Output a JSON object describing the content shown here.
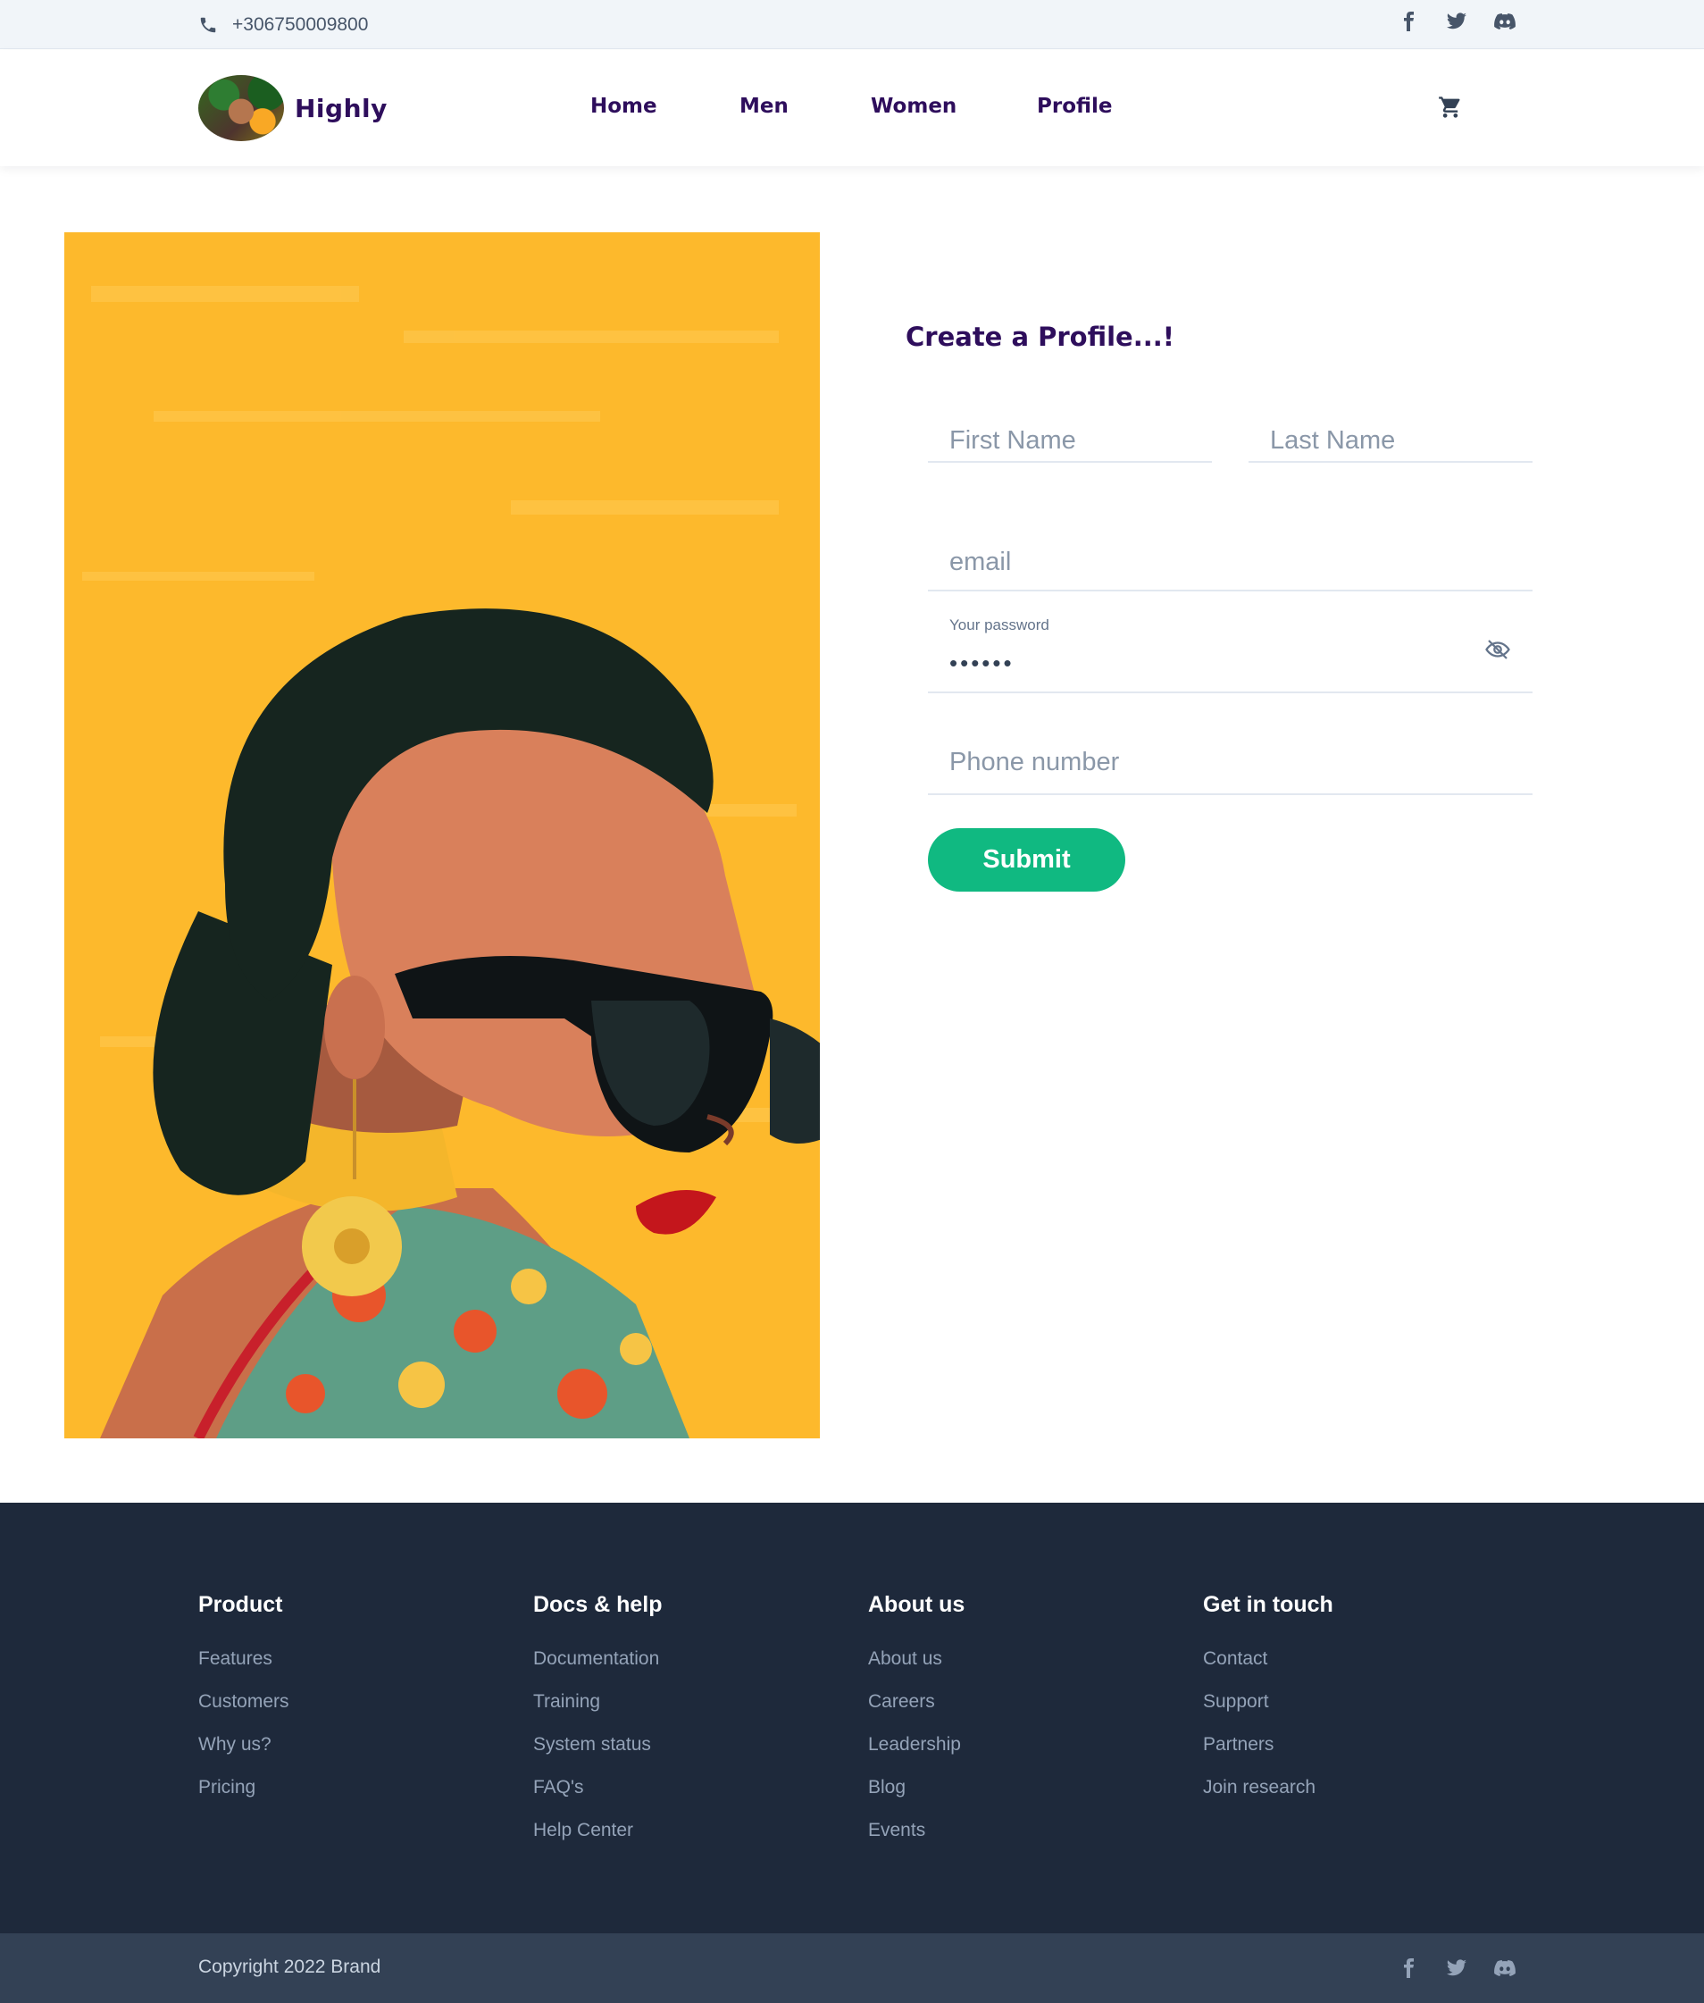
{
  "topbar": {
    "phone": "+306750009800",
    "social": [
      "facebook-icon",
      "twitter-icon",
      "discord-icon"
    ]
  },
  "header": {
    "brand": "Highly",
    "nav": [
      "Home",
      "Men",
      "Women",
      "Profile"
    ],
    "cart_icon": "cart-icon"
  },
  "form": {
    "title": "Create a Profile...!",
    "first_name_placeholder": "First Name",
    "last_name_placeholder": "Last Name",
    "email_placeholder": "email",
    "password_label": "Your password",
    "password_value": "••••••",
    "phone_placeholder": "Phone number",
    "submit": "Submit"
  },
  "footer": {
    "columns": [
      {
        "title": "Product",
        "links": [
          "Features",
          "Customers",
          "Why us?",
          "Pricing"
        ]
      },
      {
        "title": "Docs & help",
        "links": [
          "Documentation",
          "Training",
          "System status",
          "FAQ's",
          "Help Center"
        ]
      },
      {
        "title": "About us",
        "links": [
          "About us",
          "Careers",
          "Leadership",
          "Blog",
          "Events"
        ]
      },
      {
        "title": "Get in touch",
        "links": [
          "Contact",
          "Support",
          "Partners",
          "Join research"
        ]
      }
    ],
    "copyright": "Copyright 2022 Brand"
  },
  "colors": {
    "brand_purple": "#2e0e5c",
    "submit_green": "#10b981",
    "footer_bg": "#1e293b",
    "bottombar_bg": "#334155",
    "hero_yellow": "#fdb92c"
  }
}
